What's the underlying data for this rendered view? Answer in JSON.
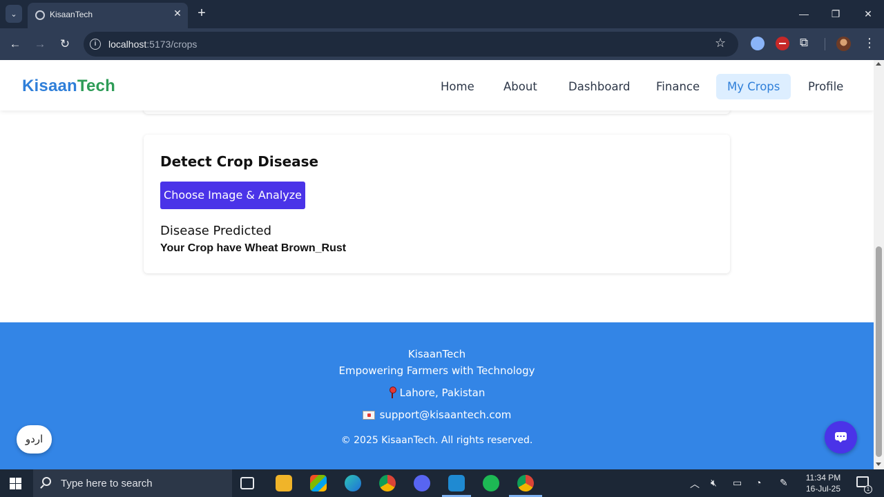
{
  "browser": {
    "tab_title": "KisaanTech",
    "url_host": "localhost",
    "url_path": ":5173/crops",
    "icons": [
      "tab-search-icon",
      "favicon-icon",
      "close-icon",
      "plus-icon",
      "back-icon",
      "forward-icon",
      "reload-icon",
      "site-info-icon",
      "star-icon",
      "extension-icon",
      "puzzle-icon",
      "profile-avatar",
      "kebab-menu-icon",
      "minimize-icon",
      "restore-icon",
      "window-close-icon"
    ]
  },
  "site": {
    "brand_part1": "Kisaan",
    "brand_part2": "Tech",
    "nav": [
      "Home",
      "About",
      "Dashboard",
      "Finance",
      "My Crops",
      "Profile"
    ],
    "active_nav": "My Crops",
    "colors": {
      "brand_blue": "#2f7fd9",
      "brand_green": "#2e9c57",
      "accent": "#4a33e8",
      "footer": "#3385e6"
    }
  },
  "detect": {
    "heading": "Detect Crop Disease",
    "button_label": "Choose Image & Analyze",
    "result_heading": "Disease Predicted",
    "result_text": "Your Crop have Wheat Brown_Rust"
  },
  "footer": {
    "brand": "KisaanTech",
    "tagline": "Empowering Farmers with Technology",
    "location": "Lahore, Pakistan",
    "email": "support@kisaantech.com",
    "copyright": "© 2025 KisaanTech. All rights reserved."
  },
  "floating": {
    "language_button": "اردو",
    "chat_icon": "chat-icon"
  },
  "taskbar": {
    "search_placeholder": "Type here to search",
    "time": "11:34 PM",
    "date": "16-Jul-25",
    "notification_count": "1",
    "apps": [
      "task-view-icon",
      "file-explorer-icon",
      "store-icon",
      "edge-icon",
      "chrome-icon",
      "discord-icon",
      "vscode-icon",
      "spotify-icon",
      "chrome-active-icon"
    ]
  }
}
